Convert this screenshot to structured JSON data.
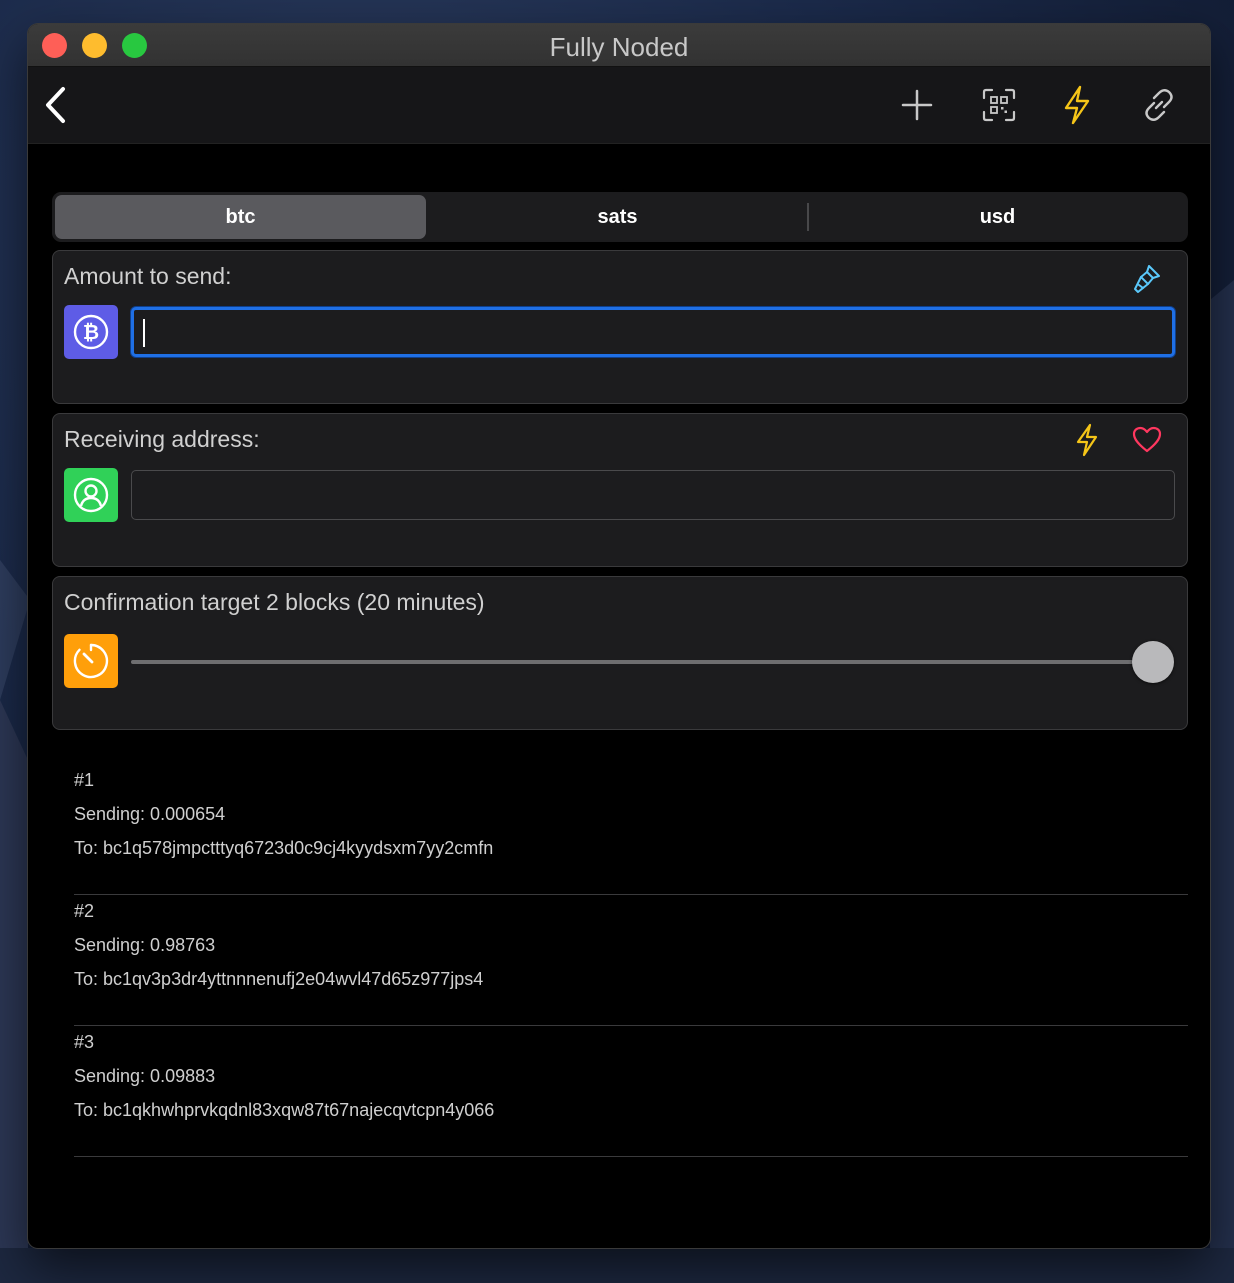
{
  "window": {
    "title": "Fully Noded"
  },
  "toolbar": {
    "back_icon": "chevron-left-icon",
    "add_icon": "plus-icon",
    "scan_icon": "qr-scan-icon",
    "lightning_icon": "lightning-bolt-icon",
    "link_icon": "link-icon"
  },
  "denomination": {
    "options": [
      "btc",
      "sats",
      "usd"
    ],
    "selected": "btc"
  },
  "amount": {
    "label": "Amount to send:",
    "value": "",
    "icon": "bitcoin-icon",
    "icon_color": "#5e5ce6",
    "sweep_icon": "sweep-brush-icon"
  },
  "address": {
    "label": "Receiving address:",
    "value": "",
    "icon": "contact-icon",
    "icon_color": "#30d158",
    "lightning_icon": "lightning-bolt-icon",
    "favorite_icon": "heart-icon"
  },
  "fee": {
    "label": "Confirmation target 2 blocks (20 minutes)",
    "icon": "timer-icon",
    "icon_color": "#ff9f0a",
    "slider_fraction": 1.0
  },
  "outputs": [
    {
      "index": "#1",
      "sending": "Sending: 0.000654",
      "to": "To: bc1q578jmpctttyq6723d0c9cj4kyydsxm7yy2cmfn"
    },
    {
      "index": "#2",
      "sending": "Sending: 0.98763",
      "to": "To: bc1qv3p3dr4yttnnnenufj2e04wvl47d65z977jps4"
    },
    {
      "index": "#3",
      "sending": "Sending: 0.09883",
      "to": "To: bc1qkhwhprvkqdnl83xqw87t67najecqvtcpn4y066"
    }
  ],
  "colors": {
    "accent_blue": "#1f6fe5",
    "lightning_yellow": "#f5c518",
    "heart_red": "#ff375f",
    "sweep_cyan": "#5ac8fa"
  }
}
